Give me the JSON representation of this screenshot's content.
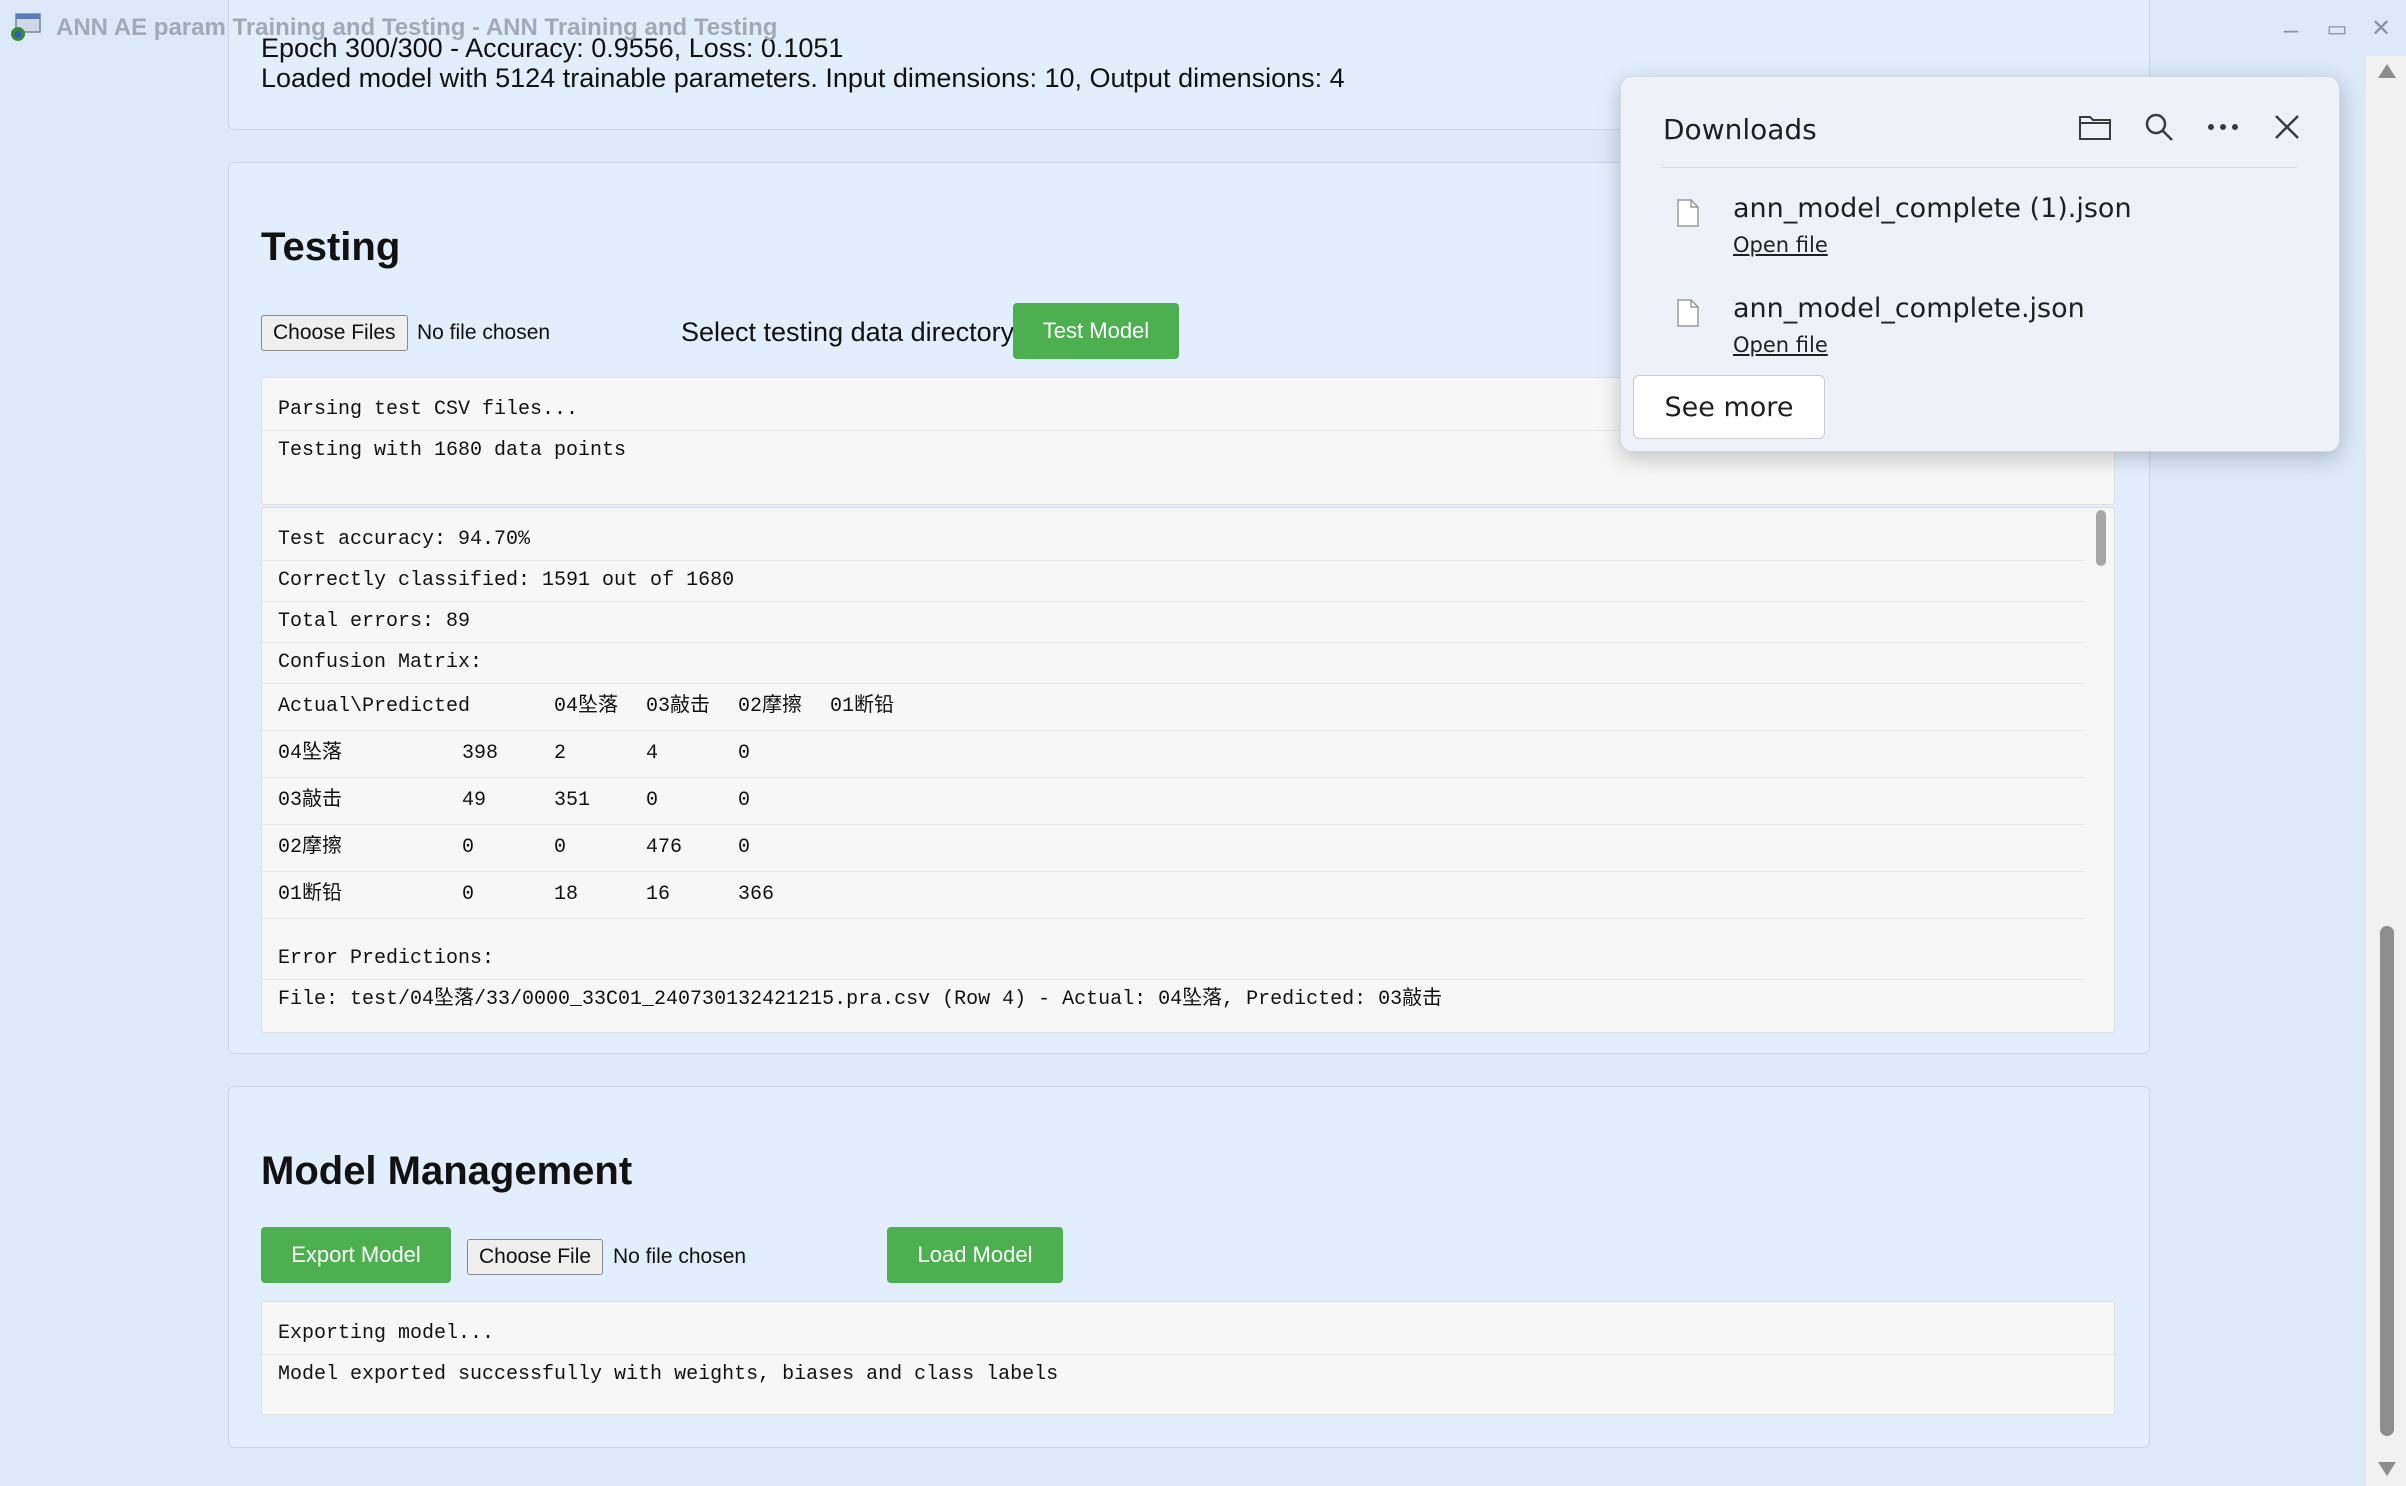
{
  "window": {
    "title": "ANN AE param Training and Testing - ANN Training and Testing",
    "minimize": "–",
    "maximize": "▭",
    "close": "✕"
  },
  "top_section": {
    "partial_line": "Epoch 300/300 - Accuracy: 0.9556, Loss: 0.1051",
    "loaded_line": "Loaded model with 5124 trainable parameters. Input dimensions: 10, Output dimensions: 4"
  },
  "testing": {
    "heading": "Testing",
    "choose_files_label": "Choose Files",
    "no_file_text": "No file chosen",
    "dir_label": "Select testing data directory",
    "test_button": "Test Model",
    "log": [
      "Parsing test CSV files...",
      "Testing with 1680 data points"
    ],
    "results": {
      "accuracy": "Test accuracy: 94.70%",
      "correct": "Correctly classified: 1591 out of 1680",
      "errors": "Total errors: 89",
      "cm_title": "Confusion Matrix:",
      "cm_header": [
        "Actual\\Predicted",
        "04坠落",
        "03敲击",
        "02摩擦",
        "01断铅"
      ],
      "cm_rows": [
        [
          "04坠落",
          "398",
          "2",
          "4",
          "0"
        ],
        [
          "03敲击",
          "49",
          "351",
          "0",
          "0"
        ],
        [
          "02摩擦",
          "0",
          "0",
          "476",
          "0"
        ],
        [
          "01断铅",
          "0",
          "18",
          "16",
          "366"
        ]
      ],
      "error_title": "Error Predictions:",
      "error_line": "File: test/04坠落/33/0000_33C01_240730132421215.pra.csv (Row 4) - Actual: 04坠落, Predicted: 03敲击"
    }
  },
  "model_management": {
    "heading": "Model Management",
    "export_button": "Export Model",
    "choose_file_label": "Choose File",
    "no_file_text": "No file chosen",
    "load_button": "Load Model",
    "log": [
      "Exporting model...",
      "Model exported successfully with weights, biases and class labels"
    ]
  },
  "downloads": {
    "title": "Downloads",
    "icons": [
      "folder-icon",
      "search-icon",
      "more-icon",
      "close-icon"
    ],
    "items": [
      {
        "name": "ann_model_complete (1).json",
        "action": "Open file"
      },
      {
        "name": "ann_model_complete.json",
        "action": "Open file"
      }
    ],
    "see_more": "See more"
  },
  "colors": {
    "page_bg": "#dde9f9",
    "card_bg": "#e3eefc",
    "accent_green": "#4caf50",
    "panel_bg": "#eef2f8"
  }
}
